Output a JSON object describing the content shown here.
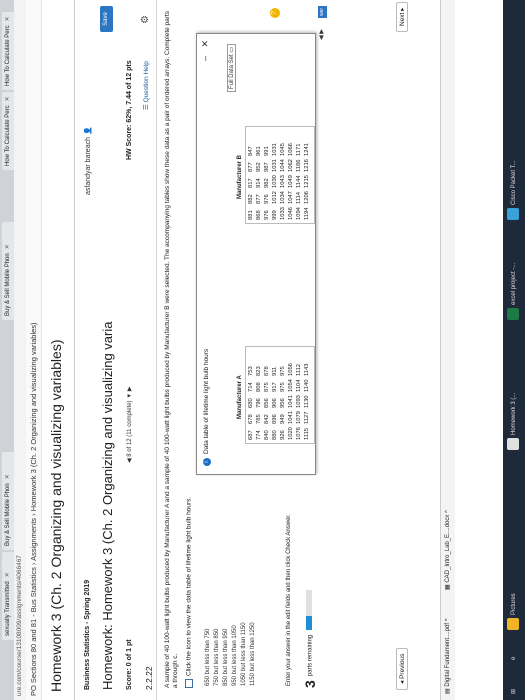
{
  "browser": {
    "tabs": [
      {
        "label": "sexually Transmitted"
      },
      {
        "label": "Buy & Sell Mobile Phon"
      },
      {
        "label": "Buy & Sell Mobile Phon"
      },
      {
        "label": "How To Calculate Perc"
      },
      {
        "label": "How To Calculate Perc"
      }
    ],
    "url": "ure.com/course/13108009/assignments/4066467"
  },
  "nav": {
    "section": "PO Sections 80 and 81 - Bus Statistics",
    "assignments": "Assignments",
    "current": "Homework 3 (Ch. 2 Organizing and visualizing variables)"
  },
  "header": {
    "title": "Homework 3 (Ch. 2 Organizing and visualizing variables)",
    "course": "Business Statistics - Spring 2019",
    "user": "asfandyar bareach",
    "subtitle": "Homework: Homework 3 (Ch. 2 Organizing and visualizing varia",
    "save": "Save",
    "score": "Score: 0 of 1 pt",
    "pager": "8 of 12 (11 complete)",
    "hw_score": "HW Score: 62%, 7.44 of 12 pts"
  },
  "question": {
    "number": "2.2.22",
    "help": "Question Help",
    "prompt": "A sample of 40 100-watt light bulbs produced by Manufacturer A and a sample of 40 100-watt light bulbs produced by Manufacturer B were selected. The accompanying tables show these data as a pair of ordered arrays. Complete parts a through c.",
    "table_link": "Click the icon to view the data table of lifetime light bulb hours.",
    "ranges": [
      "650 but less than 750",
      "750 but less than 850",
      "850 but less than 950",
      "950 but less than 1050",
      "1050 but less than 1150",
      "1150 but less than 1250"
    ],
    "enter": "Enter your answer in the edit fields and then click Check Answer.",
    "parts_num": "3",
    "parts_label": "parts remaining",
    "progress": 0.35
  },
  "dialog": {
    "title": "Data table of lifetime light bulb hours",
    "full_data": "Full Data Set",
    "mfr_a": "Manufacturer A",
    "mfr_b": "Manufacturer B",
    "a_rows": [
      [
        "687",
        "678",
        "680",
        "714",
        "753"
      ],
      [
        "774",
        "785",
        "796",
        "808",
        "823"
      ],
      [
        "840",
        "842",
        "856",
        "875",
        "878"
      ],
      [
        "880",
        "896",
        "906",
        "917",
        "911"
      ],
      [
        "926",
        "949",
        "956",
        "975",
        "975"
      ],
      [
        "1020",
        "1041",
        "1041",
        "1054",
        "1056"
      ],
      [
        "1076",
        "1079",
        "1093",
        "1104",
        "1112"
      ],
      [
        "1115",
        "1127",
        "1130",
        "1140",
        "1143"
      ]
    ],
    "b_rows": [
      [
        "881",
        "882",
        "817",
        "877",
        "847"
      ],
      [
        "868",
        "877",
        "914",
        "952",
        "961"
      ],
      [
        "976",
        "976",
        "982",
        "987",
        "991"
      ],
      [
        "999",
        "1012",
        "1030",
        "1031",
        "1031"
      ],
      [
        "1033",
        "1034",
        "1043",
        "1044",
        "1045"
      ],
      [
        "1046",
        "1047",
        "1049",
        "1062",
        "1066"
      ],
      [
        "1094",
        "1114",
        "1144",
        "1186",
        "1171"
      ],
      [
        "1194",
        "1206",
        "1215",
        "1216",
        "1241"
      ]
    ]
  },
  "footer": {
    "previous": "◂ Previous",
    "next": "Next ▸",
    "downloads": [
      "Digital Fundament....pdf",
      "CAD_Intro_Lab_E....docx"
    ],
    "taskbar": [
      "Pictures",
      "Homework 3 (...",
      "excel project -...",
      "Cisco Packet T..."
    ]
  }
}
